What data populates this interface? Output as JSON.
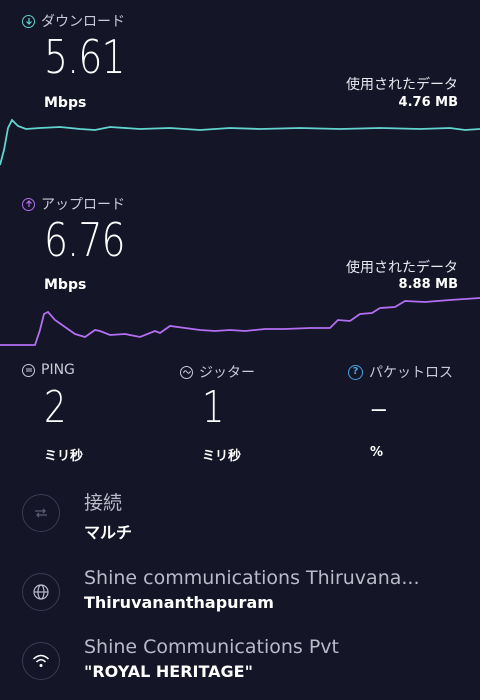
{
  "download": {
    "label": "ダウンロード",
    "speed": "5.61",
    "unit": "Mbps",
    "data_used_label": "使用されたデータ",
    "data_used_value": "4.76 MB",
    "color": "#62d4cf"
  },
  "upload": {
    "label": "アップロード",
    "speed": "6.76",
    "unit": "Mbps",
    "data_used_label": "使用されたデータ",
    "data_used_value": "8.88 MB",
    "color": "#b36ef2"
  },
  "stats": {
    "ping": {
      "label": "PING",
      "value": "2",
      "unit": "ミリ秒",
      "icon": "ping-icon"
    },
    "jitter": {
      "label": "ジッター",
      "value": "1",
      "unit": "ミリ秒",
      "icon": "jitter-icon"
    },
    "packet_loss": {
      "label": "パケットロス",
      "value": "–",
      "unit": "%",
      "icon": "help-icon"
    }
  },
  "connection": {
    "title": "接続",
    "value": "マルチ",
    "icon": "connections-icon"
  },
  "server": {
    "title": "Shine communications Thiruvana...",
    "value": "Thiruvananthapuram",
    "icon": "globe-icon"
  },
  "provider": {
    "title": "Shine Communications Pvt",
    "value": "\"ROYAL HERITAGE\"",
    "icon": "wifi-icon"
  }
}
